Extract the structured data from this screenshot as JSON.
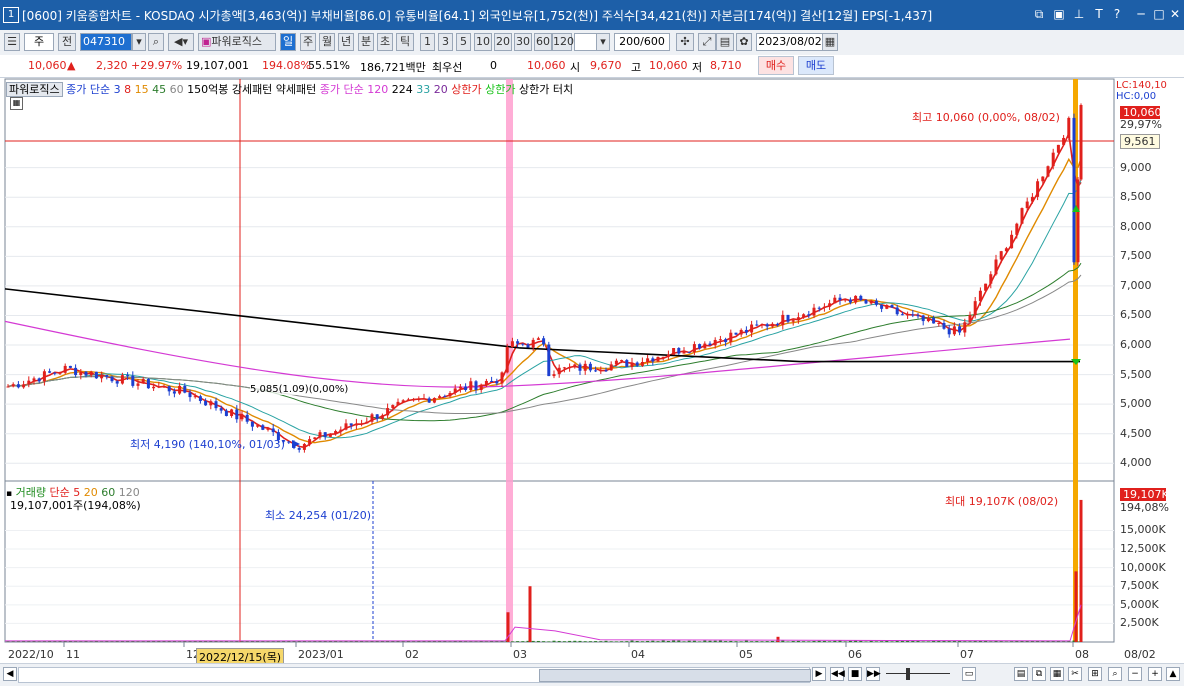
{
  "window": {
    "number": "1",
    "title": "[0600] 키움종합차트 - KOSDAQ 시가총액[3,463(억)] 부채비율[86.0] 유통비율[64.1] 외국인보유[1,752(천)] 주식수[34,421(천)] 자본금[174(억)] 결산[12월] EPS[-1,437]"
  },
  "toolbar": {
    "market": "주",
    "prev_label": "전",
    "code": "047310",
    "indicator_label": "파워로직스",
    "periods": [
      "일",
      "주",
      "월",
      "년",
      "분",
      "초",
      "틱"
    ],
    "numbers": [
      "1",
      "3",
      "5",
      "10",
      "20",
      "30",
      "60",
      "120"
    ],
    "count": "200/600",
    "date": "2023/08/02"
  },
  "info": {
    "price": "10,060",
    "change": "2,320",
    "change_pct": "+29.97%",
    "volume": "19,107,001",
    "vol_ratio": "194.08%",
    "turnover": "55.51%",
    "amount": "186,721백만",
    "broker": "최우선",
    "broker_val": "0",
    "best_price": "10,060",
    "open_label": "시",
    "open": "9,670",
    "high_label": "고",
    "high": "10,060",
    "low_label": "저",
    "low": "8,710",
    "buy_label": "매수",
    "sell_label": "매도"
  },
  "legend": {
    "name": "파워로직스",
    "ma_label": "종가 단순",
    "ma_periods": [
      "3",
      "8",
      "15",
      "45",
      "60"
    ],
    "pattern_label": "150억봉 강세패턴  약세패턴",
    "ma2_label": "종가 단순",
    "ma2_periods": [
      "120",
      "224",
      "33",
      "20"
    ],
    "upper_limit": "상한가",
    "upper_limit2": "상한가",
    "upper_touch": "상한가 터치",
    "lc": "LC:140,10",
    "hc": "HC:0,00"
  },
  "annotations": {
    "high": "최고 10,060 (0,00%, 08/02)",
    "low": "최저 4,190 (140,10%, 01/03)",
    "low_hover": "5,085(1.09)(0,00%)",
    "vol_max": "최대 19,107K (08/02)",
    "vol_min": "최소 24,254 (01/20)"
  },
  "price_axis": {
    "current": "10,060",
    "current_pct": "29,97%",
    "cursor": "9,561",
    "ticks": [
      "9,000",
      "8,500",
      "8,000",
      "7,500",
      "7,000",
      "6,500",
      "6,000",
      "5,500",
      "5,000",
      "4,500",
      "4,000"
    ]
  },
  "volume_legend": {
    "label": "거래량",
    "ma_label": "단순",
    "ma_periods": [
      "5",
      "20",
      "60",
      "120"
    ],
    "value": "19,107,001주(194,08%)"
  },
  "volume_axis": {
    "current": "19,107K",
    "current_pct": "194,08%",
    "ticks": [
      "15,000K",
      "12,500K",
      "10,000K",
      "7,500K",
      "5,000K",
      "2,500K"
    ]
  },
  "x_axis": {
    "labels": [
      "2022/10",
      "11",
      "12",
      "2023/01",
      "02",
      "03",
      "04",
      "05",
      "06",
      "07",
      "08",
      "08/02"
    ],
    "cursor_date": "2022/12/15(목)"
  },
  "chart_data": {
    "type": "line",
    "title": "",
    "series": [
      {
        "name": "종가",
        "x": [
          "2022/10",
          "2022/11",
          "2022/12",
          "2023/01",
          "2023/02",
          "2023/03",
          "2023/04",
          "2023/05",
          "2023/06",
          "2023/07",
          "2023/08/02"
        ],
        "values": [
          5300,
          5600,
          5200,
          4300,
          5000,
          5500,
          5700,
          6200,
          6800,
          6200,
          10060
        ]
      }
    ],
    "ylim": [
      3700,
      10500
    ],
    "volume": {
      "x": [
        "2023/03",
        "2023/03",
        "2023/08/02"
      ],
      "values": [
        4000000,
        7500000,
        19107001
      ]
    }
  },
  "colors": {
    "up": "#e0201c",
    "down": "#1c3fd0",
    "ma3": "#e0201c",
    "ma8": "#e08a00",
    "ma15": "#2aa3a3",
    "ma45": "#2d7d2d",
    "ma60": "#888888",
    "ma120": "#d43ad4",
    "ma224": "#000000"
  }
}
